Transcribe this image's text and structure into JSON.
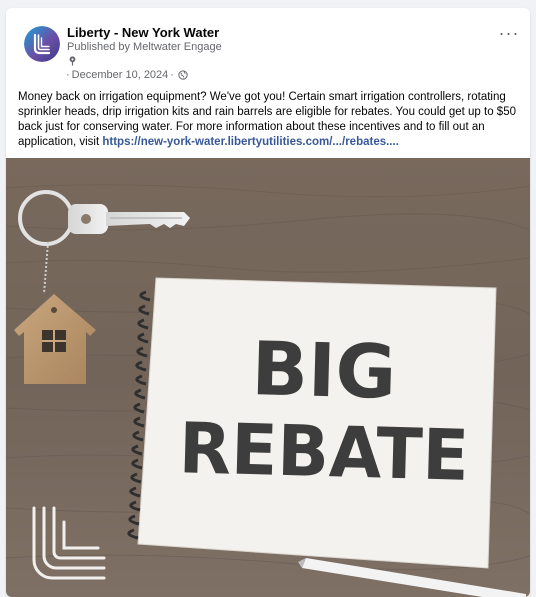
{
  "post": {
    "page_name": "Liberty - New York Water",
    "published_by": "Published by Meltwater Engage",
    "date": "December 10, 2024",
    "date_prefix": "·",
    "date_suffix": "·",
    "more_label": "···",
    "body_text": "Money back on irrigation equipment? We've got you! Certain smart irrigation controllers, rotating sprinkler heads, drip irrigation kits and rain barrels are eligible for rebates. You could get up to $50 back just for conserving water. For more information about these incentives and to fill out an application, visit ",
    "link_text": "https://new-york-water.libertyutilities.com/.../rebates....",
    "icons": {
      "avatar": "liberty-logo-avatar",
      "pin": "pin-icon",
      "audience": "globe-icon",
      "more": "more-options-icon"
    }
  },
  "photo": {
    "headline_line1": "BIG",
    "headline_line2": "REBATE",
    "description_icons": [
      "house-keychain",
      "key",
      "spiral-notepad",
      "pencil",
      "liberty-logo-watermark"
    ]
  },
  "colors": {
    "page_background": "#f0f2f5",
    "card_background": "#ffffff",
    "link": "#385898",
    "secondary_text": "#65676b",
    "wood": "#6b5a4d",
    "paper": "#f4f2ee"
  }
}
